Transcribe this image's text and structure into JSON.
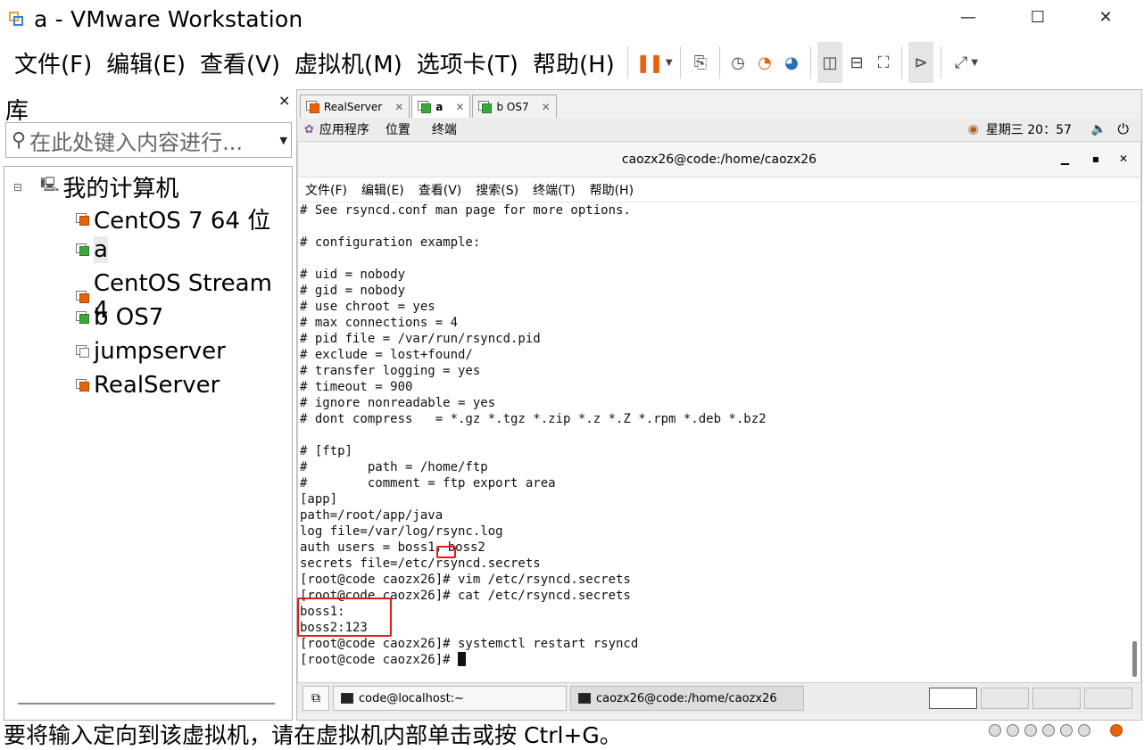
{
  "window": {
    "title": "a - VMware Workstation",
    "minimize_glyph": "—",
    "maximize_glyph": "☐",
    "close_glyph": "✕"
  },
  "menubar": [
    "文件(F)",
    "编辑(E)",
    "查看(V)",
    "虚拟机(M)",
    "选项卡(T)",
    "帮助(H)"
  ],
  "library": {
    "title": "库",
    "close_glyph": "×",
    "search_placeholder": "在此处键入内容进行...",
    "root": "我的计算机",
    "items": [
      "CentOS 7 64 位",
      "a",
      "CentOS Stream 4",
      "b OS7",
      "jumpserver",
      "RealServer"
    ]
  },
  "tabs": [
    {
      "label": "RealServer"
    },
    {
      "label": "a"
    },
    {
      "label": "b OS7"
    }
  ],
  "guest_panel": {
    "apps": "应用程序",
    "places": "位置",
    "terminal": "终端",
    "clock": "星期三 20：57"
  },
  "terminal": {
    "title": "caozx26@code:/home/caozx26",
    "menu": [
      "文件(F)",
      "编辑(E)",
      "查看(V)",
      "搜索(S)",
      "终端(T)",
      "帮助(H)"
    ],
    "lines": [
      "# See rsyncd.conf man page for more options.",
      "",
      "# configuration example:",
      "",
      "# uid = nobody",
      "# gid = nobody",
      "# use chroot = yes",
      "# max connections = 4",
      "# pid file = /var/run/rsyncd.pid",
      "# exclude = lost+found/",
      "# transfer logging = yes",
      "# timeout = 900",
      "# ignore nonreadable = yes",
      "# dont compress   = *.gz *.tgz *.zip *.z *.Z *.rpm *.deb *.bz2",
      "",
      "# [ftp]",
      "#        path = /home/ftp",
      "#        comment = ftp export area",
      "[app]",
      "path=/root/app/java",
      "log file=/var/log/rsync.log",
      "auth users = boss1，boss2",
      "secrets file=/etc/rsyncd.secrets",
      "[root@code caozx26]# vim /etc/rsyncd.secrets",
      "[root@code caozx26]# cat /etc/rsyncd.secrets",
      "boss1:",
      "boss2:123",
      "[root@code caozx26]# systemctl restart rsyncd",
      "[root@code caozx26]# "
    ]
  },
  "taskbar": {
    "task1": "code@localhost:~",
    "task2": "caozx26@code:/home/caozx26"
  },
  "status_text": "要将输入定向到该虚拟机，请在虚拟机内部单击或按 Ctrl+G。",
  "colors": {
    "accent_orange": "#e8630a",
    "highlight_red": "#e21b1b"
  }
}
